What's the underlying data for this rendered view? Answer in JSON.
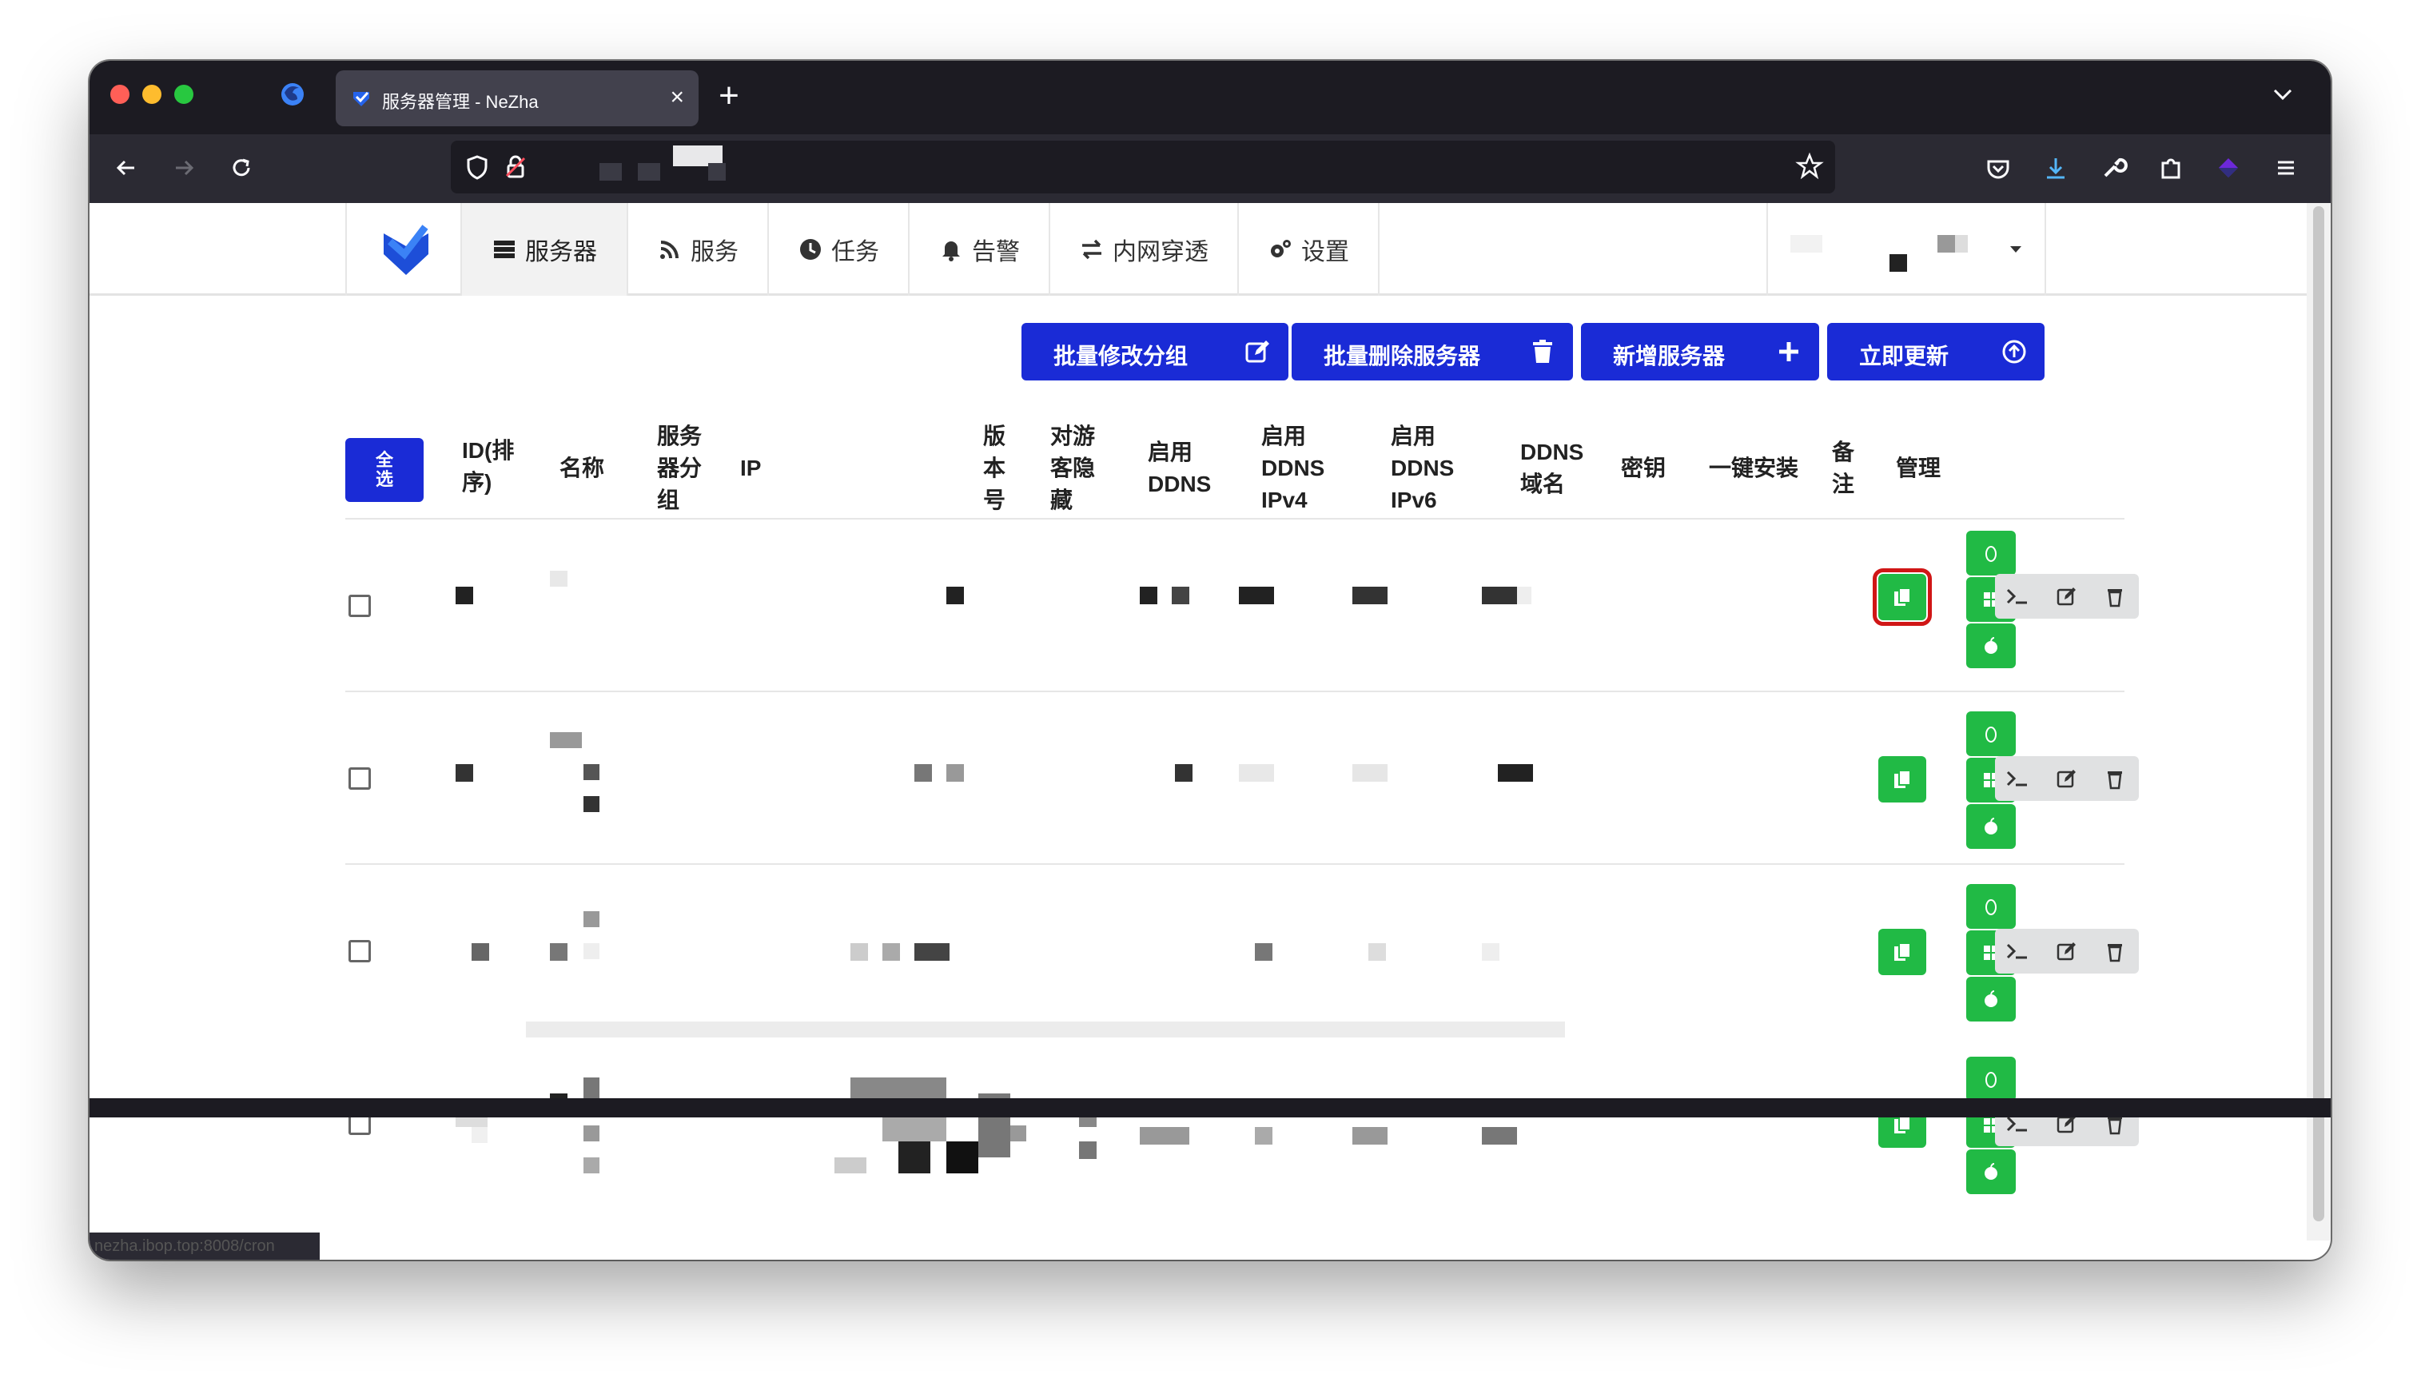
{
  "browser": {
    "tab_title": "服务器管理 - NeZha",
    "tab_close": "×",
    "new_tab": "+",
    "status_url": "nezha.ibop.top:8008/cron"
  },
  "menu": {
    "items": [
      {
        "label": "服务器",
        "icon": "server-icon"
      },
      {
        "label": "服务",
        "icon": "rss-icon"
      },
      {
        "label": "任务",
        "icon": "clock-icon"
      },
      {
        "label": "告警",
        "icon": "bell-icon"
      },
      {
        "label": "内网穿透",
        "icon": "exchange-icon"
      },
      {
        "label": "设置",
        "icon": "cogs-icon"
      }
    ]
  },
  "toolbar": {
    "batch_group": "批量修改分组",
    "batch_delete": "批量删除服务器",
    "add_server": "新增服务器",
    "update_now": "立即更新"
  },
  "table": {
    "select_all": "全选",
    "headers": {
      "id": "ID(排序)",
      "name": "名称",
      "group": "服务器分组",
      "ip": "IP",
      "version": "版本号",
      "hide_guest": "对游客隐藏",
      "ddns": "启用DDNS",
      "ddns_v4": "启用DDNS IPv4",
      "ddns_v6": "启用DDNS IPv6",
      "ddns_domain": "DDNS域名",
      "secret": "密钥",
      "install": "一键安装",
      "note": "备注",
      "manage": "管理"
    },
    "rows": 4,
    "selected_copy_row": 1
  },
  "colors": {
    "primary": "#1a2bd6",
    "green": "#21ba45",
    "highlight": "#d01616"
  }
}
